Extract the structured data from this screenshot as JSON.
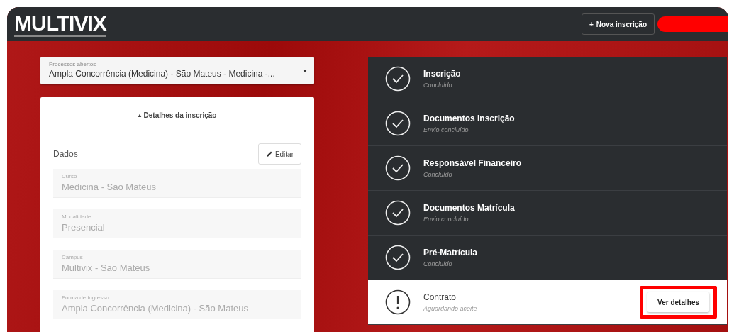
{
  "header": {
    "logo": "MULTIVIX",
    "new_button": {
      "icon": "+",
      "label": "Nova inscrição"
    },
    "redacted": true
  },
  "process_select": {
    "label": "Processos abertos",
    "value": "Ampla Concorrência (Medicina) - São Mateus - Medicina -..."
  },
  "details": {
    "title_icon": "▴",
    "title": "Detalhes da inscrição",
    "section": "Dados",
    "edit_button": "Editar",
    "fields": [
      {
        "label": "Curso",
        "value": "Medicina - São Mateus",
        "disabled": true
      },
      {
        "label": "Modalidade",
        "value": "Presencial",
        "disabled": true
      },
      {
        "label": "Campus",
        "value": "Multivix - São Mateus",
        "disabled": true
      },
      {
        "label": "Forma de ingresso",
        "value": "Ampla Concorrência (Medicina) - São Mateus",
        "disabled": true
      }
    ]
  },
  "steps": [
    {
      "title": "Inscrição",
      "status_text": "Concluído",
      "completed": true
    },
    {
      "title": "Documentos Inscrição",
      "status_text": "Envio concluído",
      "completed": true
    },
    {
      "title": "Responsável Financeiro",
      "status_text": "Concluído",
      "completed": true
    },
    {
      "title": "Documentos Matrícula",
      "status_text": "Envio concluído",
      "completed": true
    },
    {
      "title": "Pré-Matrícula",
      "status_text": "Concluído",
      "completed": true
    },
    {
      "title": "Contrato",
      "status_text": "Aguardando aceite",
      "completed": false,
      "action": {
        "label": "Ver detalhes",
        "highlighted": true
      }
    }
  ]
}
